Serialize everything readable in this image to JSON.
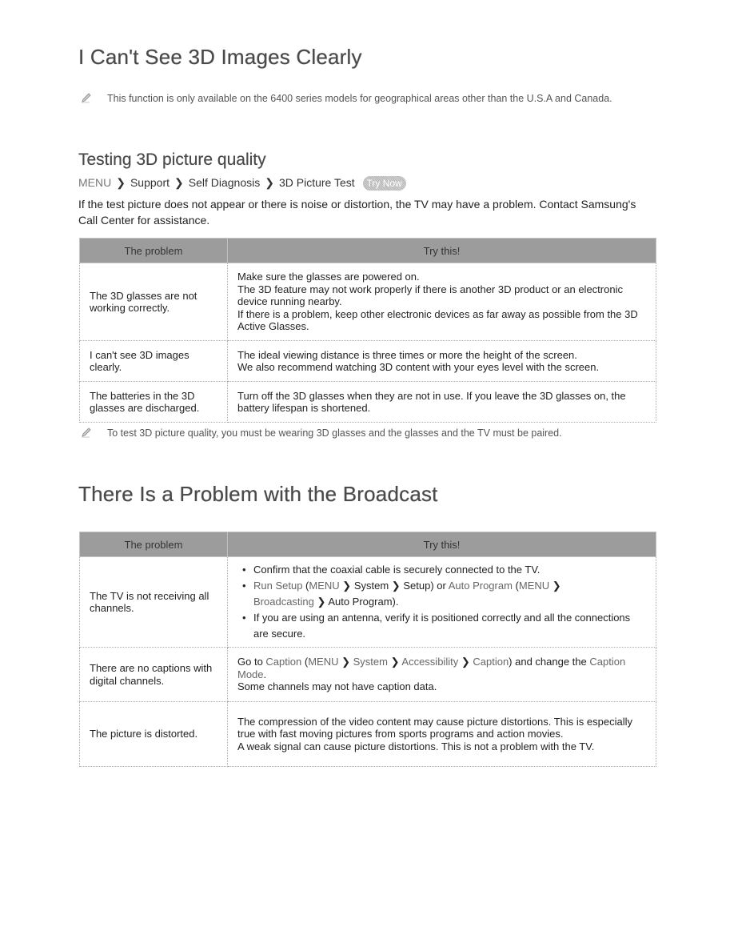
{
  "section1": {
    "title": "I Can't See 3D Images Clearly",
    "note_top": "This function is only available on the 6400 series models for geographical areas other than the U.S.A and Canada.",
    "subsection": {
      "title": "Testing 3D picture quality",
      "path": {
        "items": [
          "MENU",
          "Support",
          "Self Diagnosis",
          "3D Picture Test"
        ],
        "separator": ">",
        "badge": "Try Now"
      },
      "paragraph": "If the test picture does not appear or there is noise or distortion, the TV may have a problem. Contact Samsung's Call Center for assistance.",
      "table": {
        "headers": [
          "The problem",
          "Try this!"
        ],
        "rows": [
          {
            "problem": "The 3D glasses are not working correctly.",
            "solution": [
              "Make sure the glasses are powered on.",
              "The 3D feature may not work properly if there is another 3D product or an electronic device running nearby.",
              "If there is a problem, keep other electronic devices as far away as possible from the 3D Active Glasses."
            ]
          },
          {
            "problem": "I can't see 3D images clearly.",
            "solution": [
              "The ideal viewing distance is three times or more the height of the screen.",
              "We also recommend watching 3D content with your eyes level with the screen."
            ]
          },
          {
            "problem": "The batteries in the 3D glasses are discharged.",
            "solution": [
              "Turn off the 3D glasses when they are not in use. If you leave the 3D glasses on, the battery lifespan is shortened."
            ]
          }
        ]
      },
      "note_bottom": "To test 3D picture quality, you must be wearing 3D glasses and the glasses and the TV must be paired."
    }
  },
  "section2": {
    "title": "There Is a Problem with the Broadcast",
    "table": {
      "headers": [
        "The problem",
        "Try this!"
      ],
      "rows": [
        {
          "problem": "The TV is not receiving all channels.",
          "bullets": {
            "b1": "Confirm that the coaxial cable is securely connected to the TV.",
            "b2": {
              "run_setup": "Run Setup",
              "open1": " (",
              "menu": "MENU",
              "system": "System",
              "setup": "Setup",
              "close_or": ") or ",
              "auto_program": "Auto Program",
              "open2": " (",
              "menu2": "MENU",
              "broadcasting": "Broadcasting",
              "auto_program2": "Auto Program",
              "end": ")."
            },
            "b3": "If you are using an antenna, verify it is positioned correctly and all the connections are secure."
          }
        },
        {
          "problem": "There are no captions with digital channels.",
          "solution": {
            "go_to": "Go to ",
            "caption": "Caption",
            "open": " (",
            "menu": "MENU",
            "system": "System",
            "accessibility": "Accessibility",
            "caption2": "Caption",
            "change": ") and change the ",
            "caption_mode": "Caption Mode",
            "period": ".",
            "line2": "Some channels may not have caption data."
          }
        },
        {
          "problem": "The picture is distorted.",
          "solution": [
            "The compression of the video content may cause picture distortions. This is especially true with fast moving pictures from sports programs and action movies.",
            "A weak signal can cause picture distortions. This is not a problem with the TV."
          ]
        }
      ]
    }
  },
  "icons": {
    "note": "pencil-icon",
    "separator": "chevron-right-icon"
  },
  "colors": {
    "heading": "#4a4a4a",
    "highlight": "#666666",
    "table_header": "#c8c8c8"
  }
}
